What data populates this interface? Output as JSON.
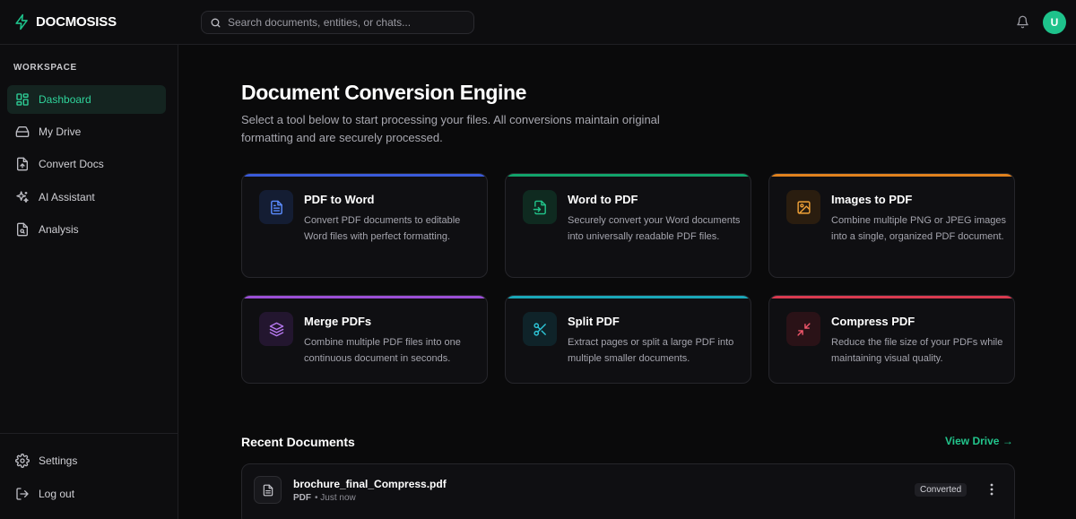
{
  "app": {
    "name": "DOCMOSISS",
    "user_initial": "U",
    "accent": "#1ec28b"
  },
  "search": {
    "placeholder": "Search documents, entities, or chats..."
  },
  "sidebar": {
    "section_label": "WORKSPACE",
    "items": [
      {
        "label": "Dashboard",
        "icon": "dashboard-icon",
        "active": true
      },
      {
        "label": "My Drive",
        "icon": "drive-icon"
      },
      {
        "label": "Convert Docs",
        "icon": "convert-icon"
      },
      {
        "label": "AI Assistant",
        "icon": "sparkles-icon"
      },
      {
        "label": "Analysis",
        "icon": "analysis-icon"
      }
    ],
    "bottom_items": [
      {
        "label": "Settings",
        "icon": "gear-icon"
      },
      {
        "label": "Log out",
        "icon": "logout-icon"
      }
    ]
  },
  "main": {
    "title": "Document Conversion Engine",
    "subtitle": "Select a tool below to start processing your files. All conversions maintain original formatting and are securely processed.",
    "tools": [
      {
        "title": "PDF to Word",
        "desc": "Convert PDF documents to editable Word files with perfect formatting.",
        "color": "#3b5bdb",
        "icon": "file-text-icon"
      },
      {
        "title": "Word to PDF",
        "desc": "Securely convert your Word documents into universally readable PDF files.",
        "color": "#12a36b",
        "icon": "file-import-icon"
      },
      {
        "title": "Images to PDF",
        "desc": "Combine multiple PNG or JPEG images into a single, organized PDF document.",
        "color": "#e0821e",
        "icon": "image-icon"
      },
      {
        "title": "Merge PDFs",
        "desc": "Combine multiple PDF files into one continuous document in seconds.",
        "color": "#9b4fd6",
        "icon": "layers-icon"
      },
      {
        "title": "Split PDF",
        "desc": "Extract pages or split a large PDF into multiple smaller documents.",
        "color": "#1aa7b8",
        "icon": "scissors-icon"
      },
      {
        "title": "Compress PDF",
        "desc": "Reduce the file size of your PDFs while maintaining visual quality.",
        "color": "#d93a4f",
        "icon": "minimize-icon"
      }
    ],
    "recent": {
      "title": "Recent Documents",
      "view_all": "View Drive →",
      "items": [
        {
          "name": "brochure_final_Compress.pdf",
          "type": "PDF",
          "time": "• Just now",
          "status": "Converted"
        }
      ]
    }
  }
}
